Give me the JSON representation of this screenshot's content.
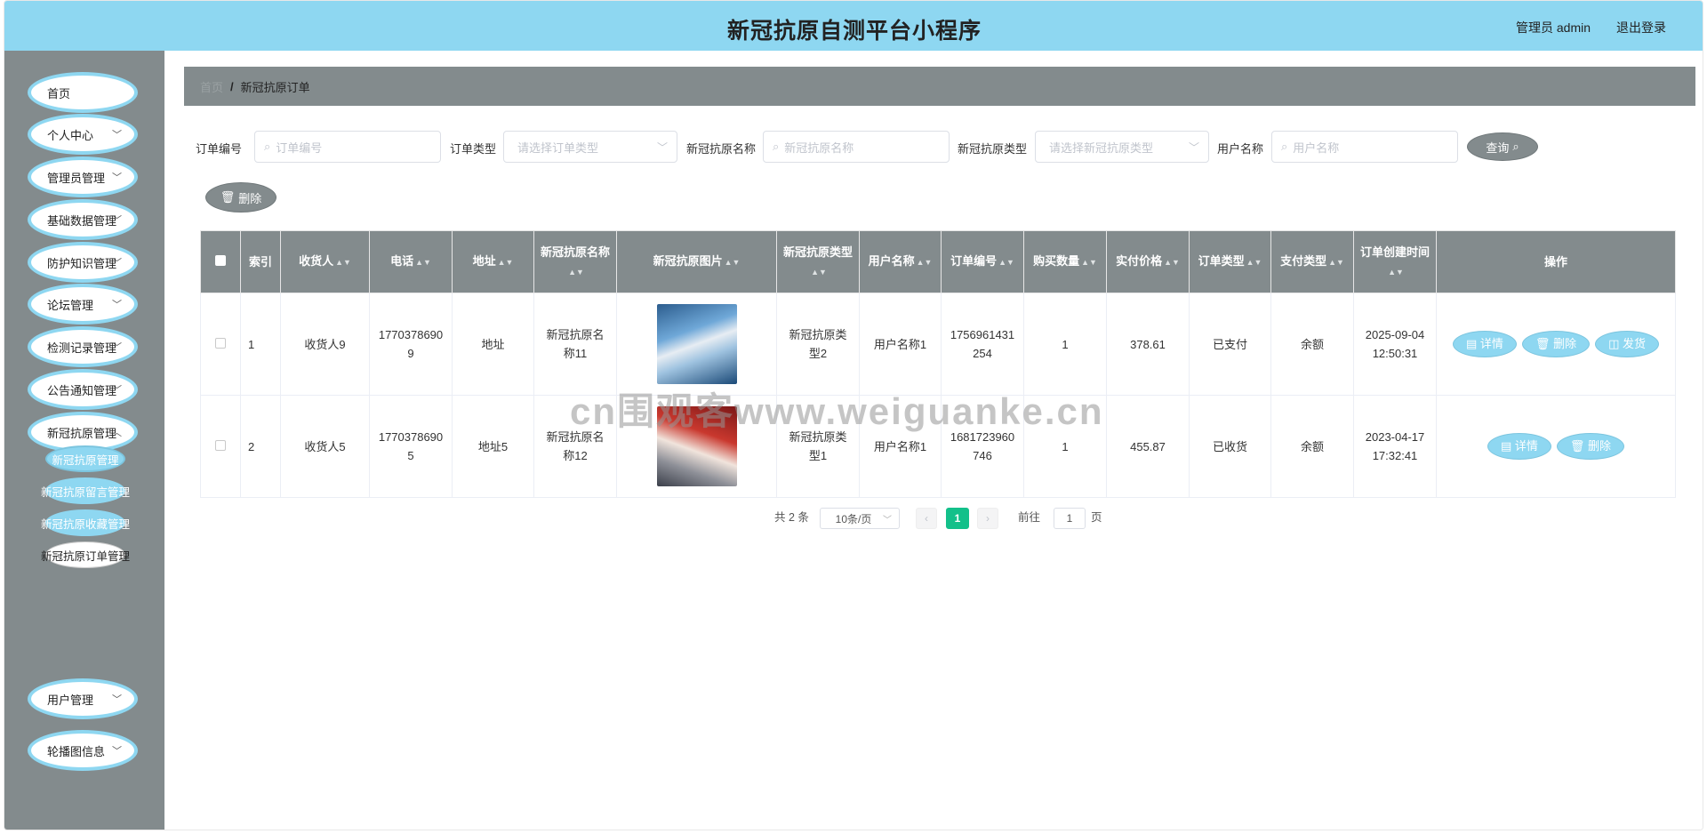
{
  "header": {
    "title": "新冠抗原自测平台小程序",
    "user": "管理员 admin",
    "logout": "退出登录"
  },
  "sidebar": {
    "items": [
      {
        "label": "首页",
        "chevron": false
      },
      {
        "label": "个人中心",
        "chevron": true
      },
      {
        "label": "管理员管理",
        "chevron": true
      },
      {
        "label": "基础数据管理",
        "chevron": true
      },
      {
        "label": "防护知识管理",
        "chevron": true
      },
      {
        "label": "论坛管理",
        "chevron": true
      },
      {
        "label": "检测记录管理",
        "chevron": true
      },
      {
        "label": "公告通知管理",
        "chevron": true
      },
      {
        "label": "新冠抗原管理",
        "chevron": true
      },
      {
        "label": "用户管理",
        "chevron": true
      },
      {
        "label": "轮播图信息",
        "chevron": true
      }
    ],
    "sub_items": [
      {
        "label": "新冠抗原管理"
      },
      {
        "label": "新冠抗原留言管理"
      },
      {
        "label": "新冠抗原收藏管理"
      },
      {
        "label": "新冠抗原订单管理"
      }
    ]
  },
  "breadcrumb": {
    "home": "首页",
    "separator": "/",
    "current": "新冠抗原订单"
  },
  "search": {
    "order_no_label": "订单编号",
    "order_no_placeholder": "订单编号",
    "order_type_label": "订单类型",
    "order_type_placeholder": "请选择订单类型",
    "antigen_name_label": "新冠抗原名称",
    "antigen_name_placeholder": "新冠抗原名称",
    "antigen_type_label": "新冠抗原类型",
    "antigen_type_placeholder": "请选择新冠抗原类型",
    "user_name_label": "用户名称",
    "user_name_placeholder": "用户名称",
    "query_button": "查询",
    "delete_button": "删除"
  },
  "table": {
    "headers": [
      "",
      "索引",
      "收货人",
      "电话",
      "地址",
      "新冠抗原名称",
      "新冠抗原图片",
      "新冠抗原类型",
      "用户名称",
      "订单编号",
      "购买数量",
      "实付价格",
      "订单类型",
      "支付类型",
      "订单创建时间",
      "操作"
    ],
    "rows": [
      {
        "index": "1",
        "receiver": "收货人9",
        "phone": "17703786909",
        "address": "地址",
        "name": "新冠抗原名称11",
        "type": "新冠抗原类型2",
        "user": "用户名称1",
        "order_no": "1756961431254",
        "qty": "1",
        "price": "378.61",
        "order_type": "已支付",
        "pay_type": "余额",
        "created": "2025-09-04 12:50:31",
        "actions": [
          "详情",
          "删除",
          "发货"
        ]
      },
      {
        "index": "2",
        "receiver": "收货人5",
        "phone": "17703786905",
        "address": "地址5",
        "name": "新冠抗原名称12",
        "type": "新冠抗原类型1",
        "user": "用户名称1",
        "order_no": "1681723960746",
        "qty": "1",
        "price": "455.87",
        "order_type": "已收货",
        "pay_type": "余额",
        "created": "2023-04-17 17:32:41",
        "actions": [
          "详情",
          "删除"
        ]
      }
    ]
  },
  "pagination": {
    "total": "共 2 条",
    "page_size": "10条/页",
    "current_page": "1",
    "goto_label": "前往",
    "goto_value": "1",
    "page_suffix": "页"
  },
  "watermark": "cn围观客www.weiguanke.cn",
  "colors": {
    "header": "#8ed7f1",
    "sidebar": "#838b8d",
    "accent_pill": "#8ed7f1",
    "page_active": "#13c08a"
  }
}
